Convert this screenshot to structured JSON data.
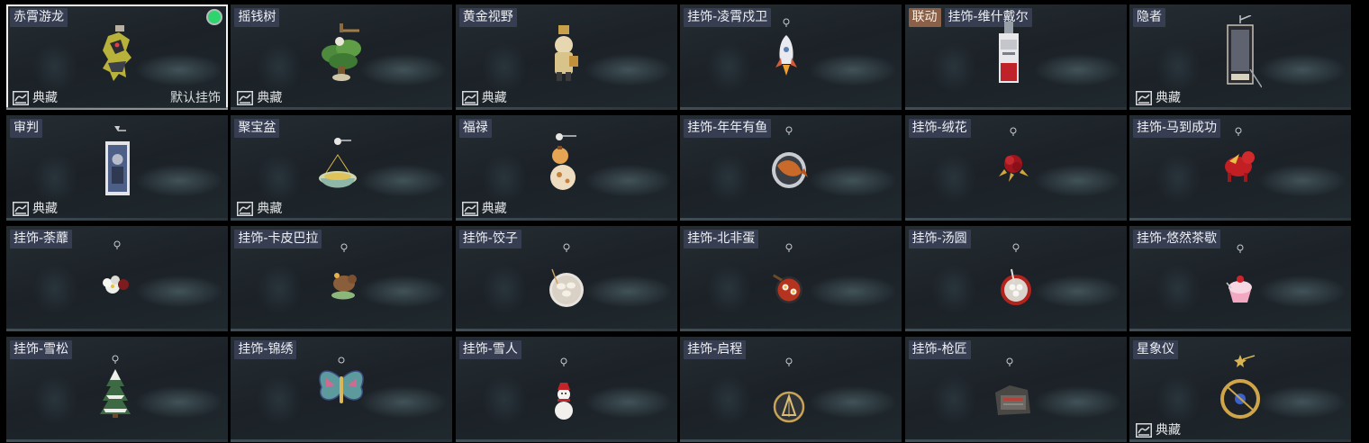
{
  "colors": {
    "selected_border": "#f3f3f3",
    "equipped_dot": "#2fd46e",
    "tag_background": "#3a4056",
    "collab_tag_background": "#8a6048"
  },
  "items": [
    {
      "tags": [
        "赤霄游龙"
      ],
      "icon": "dragon-figure-icon",
      "collection": "典藏",
      "default_label": "默认挂饰",
      "equipped": true,
      "selected": true
    },
    {
      "tags": [
        "摇钱树"
      ],
      "icon": "money-tree-icon",
      "collection": "典藏"
    },
    {
      "tags": [
        "黄金视野"
      ],
      "icon": "golden-figure-icon",
      "collection": "典藏"
    },
    {
      "tags": [
        "挂饰-凌霄戍卫"
      ],
      "icon": "rocket-charm-icon"
    },
    {
      "tags": [
        "联动",
        "挂饰-维什戴尔"
      ],
      "icon": "card-tag-charm-icon"
    },
    {
      "tags": [
        "隐者"
      ],
      "icon": "hermit-tarot-card-icon",
      "collection": "典藏"
    },
    {
      "tags": [
        "审判"
      ],
      "icon": "judgment-tarot-card-icon",
      "collection": "典藏"
    },
    {
      "tags": [
        "聚宝盆"
      ],
      "icon": "treasure-bowl-icon",
      "collection": "典藏"
    },
    {
      "tags": [
        "福禄"
      ],
      "icon": "gourd-charm-icon",
      "collection": "典藏"
    },
    {
      "tags": [
        "挂饰-年年有鱼"
      ],
      "icon": "fish-plate-charm-icon"
    },
    {
      "tags": [
        "挂饰-绒花"
      ],
      "icon": "velvet-flower-charm-icon"
    },
    {
      "tags": [
        "挂饰-马到成功"
      ],
      "icon": "red-horse-charm-icon"
    },
    {
      "tags": [
        "挂饰-荼蘼"
      ],
      "icon": "white-flower-charm-icon"
    },
    {
      "tags": [
        "挂饰-卡皮巴拉"
      ],
      "icon": "capybara-charm-icon"
    },
    {
      "tags": [
        "挂饰-饺子"
      ],
      "icon": "dumpling-plate-charm-icon"
    },
    {
      "tags": [
        "挂饰-北非蛋"
      ],
      "icon": "shakshuka-pan-charm-icon"
    },
    {
      "tags": [
        "挂饰-汤圆"
      ],
      "icon": "tangyuan-bowl-charm-icon"
    },
    {
      "tags": [
        "挂饰-悠然茶歇"
      ],
      "icon": "cupcake-charm-icon"
    },
    {
      "tags": [
        "挂饰-雪松"
      ],
      "icon": "snowy-pine-charm-icon"
    },
    {
      "tags": [
        "挂饰-锦绣"
      ],
      "icon": "butterfly-charm-icon"
    },
    {
      "tags": [
        "挂饰-雪人"
      ],
      "icon": "snowman-charm-icon"
    },
    {
      "tags": [
        "挂饰-启程"
      ],
      "icon": "compass-medal-charm-icon"
    },
    {
      "tags": [
        "挂饰-枪匠"
      ],
      "icon": "gunsmith-box-charm-icon"
    },
    {
      "tags": [
        "星象仪"
      ],
      "icon": "astrolabe-charm-icon",
      "collection": "典藏"
    }
  ]
}
